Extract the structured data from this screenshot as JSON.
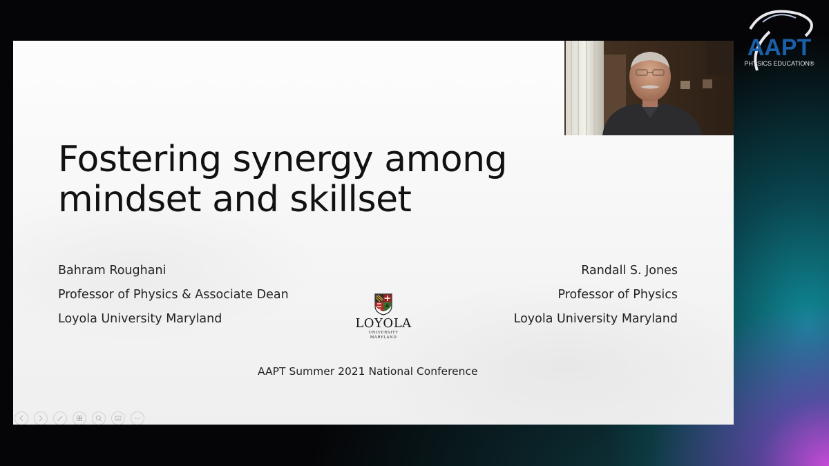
{
  "slide": {
    "title_line1": "Fostering synergy among",
    "title_line2": "mindset and skillset",
    "left_author": {
      "name": "Bahram Roughani",
      "role": "Professor of Physics & Associate Dean",
      "affiliation": "Loyola University Maryland"
    },
    "right_author": {
      "name": "Randall S. Jones",
      "role": "Professor of Physics",
      "affiliation": "Loyola University Maryland"
    },
    "conference": "AAPT Summer 2021 National Conference",
    "logo": {
      "name": "LOYOLA",
      "subtitle": "UNIVERSITY MARYLAND"
    }
  },
  "branding": {
    "aapt_title": "AAPT",
    "aapt_tagline": "PHYSICS EDUCATION®",
    "accent": "#1b5fa8"
  },
  "controls": [
    {
      "icon": "previous-slide-icon"
    },
    {
      "icon": "next-slide-icon"
    },
    {
      "icon": "pen-icon"
    },
    {
      "icon": "slides-icon"
    },
    {
      "icon": "zoom-icon"
    },
    {
      "icon": "subtitles-icon"
    },
    {
      "icon": "more-options-icon"
    }
  ]
}
